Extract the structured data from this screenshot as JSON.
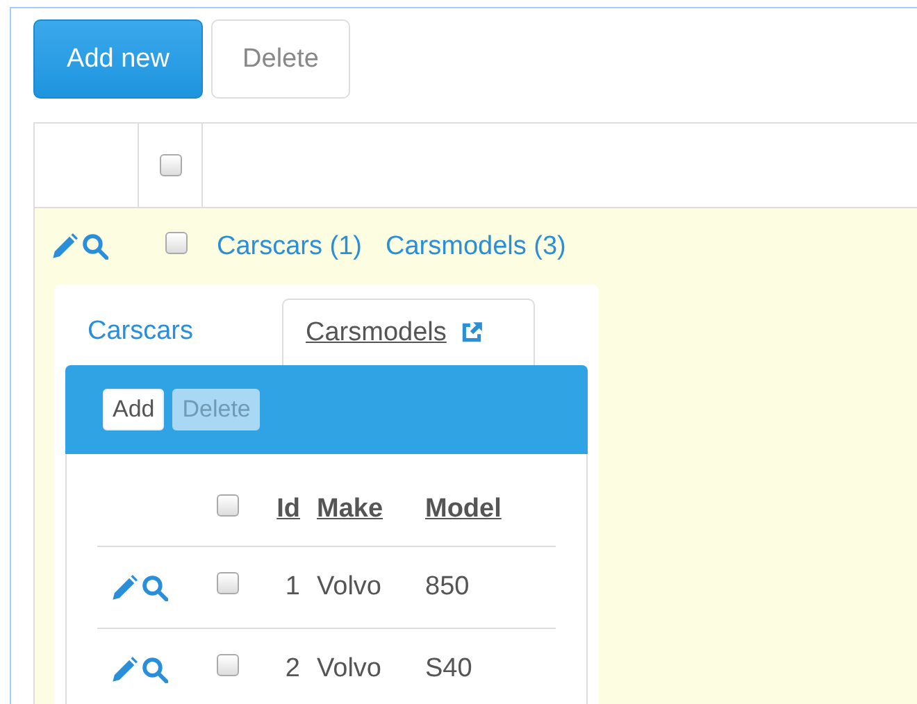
{
  "toolbar": {
    "buttons": [
      {
        "label": "Add new",
        "kind": "primary"
      },
      {
        "label": "Delete",
        "kind": "default"
      }
    ]
  },
  "table": {
    "header_checkbox": {
      "checked": false
    },
    "rows": [
      {
        "checked": false,
        "links": [
          "Carscars (1)",
          "Carsmodels (3)"
        ],
        "detail": {
          "tabs": [
            {
              "label": "Carscars",
              "selected": false
            },
            {
              "label": "Carsmodels",
              "selected": true
            }
          ],
          "buttons": [
            {
              "label": "Add",
              "disabled": false
            },
            {
              "label": "Delete",
              "disabled": true
            }
          ],
          "header_checkbox": {
            "checked": false
          },
          "columns": [
            "Id",
            "Make",
            "Model"
          ],
          "rows": [
            {
              "checked": false,
              "cells": [
                "1",
                "Volvo",
                "850"
              ]
            },
            {
              "checked": false,
              "cells": [
                "2",
                "Volvo",
                "S40"
              ]
            }
          ]
        }
      }
    ]
  }
}
